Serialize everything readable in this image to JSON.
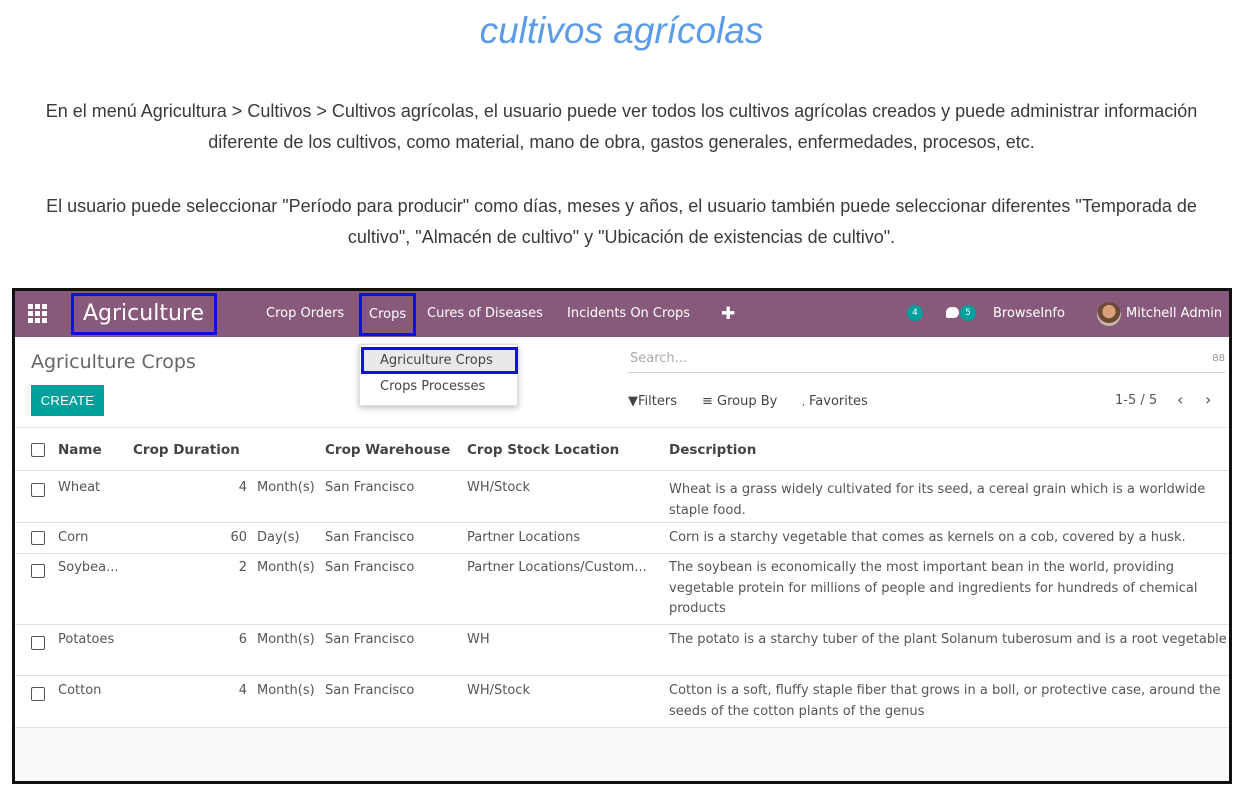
{
  "doc": {
    "title": "cultivos agrícolas",
    "para1": "En el menú Agricultura > Cultivos > Cultivos agrícolas, el usuario puede ver todos los cultivos agrícolas creados y puede administrar información diferente de los cultivos, como material, mano de obra, gastos generales, enfermedades, procesos, etc.",
    "para2": "El usuario puede seleccionar \"Período para producir\" como días, meses y años, el usuario también puede seleccionar diferentes \"Temporada de cultivo\", \"Almacén de cultivo\" y \"Ubicación de existencias de cultivo\"."
  },
  "navbar": {
    "brand": "Agriculture",
    "menu": [
      "Crop Orders",
      "Crops",
      "Cures of Diseases",
      "Incidents On Crops"
    ],
    "plus": "✚",
    "activity_count": "4",
    "message_count": "5",
    "company": "BrowseInfo",
    "user": "Mitchell Admin"
  },
  "dropdown": {
    "items": [
      "Agriculture Crops",
      "Crops Processes"
    ]
  },
  "control": {
    "title": "Agriculture Crops",
    "create": "CREATE",
    "search_placeholder": "Search...",
    "search_option": "88",
    "filters": "Filters",
    "group_by": "Group By",
    "favorites": "Favorites",
    "pager": "1-5 / 5",
    "prev": "‹",
    "next": "›"
  },
  "table": {
    "headers": [
      "Name",
      "Crop Duration",
      "Crop Warehouse",
      "Crop Stock Location",
      "Description"
    ],
    "rows": [
      {
        "name": "Wheat",
        "duration": "4",
        "unit": "Month(s)",
        "warehouse": "San Francisco",
        "location": "WH/Stock",
        "description": "Wheat is a grass widely cultivated for its seed, a cereal grain which is a worldwide staple food."
      },
      {
        "name": "Corn",
        "duration": "60",
        "unit": "Day(s)",
        "warehouse": "San Francisco",
        "location": "Partner Locations",
        "description": "Corn is a starchy vegetable that comes as kernels on a cob, covered by a husk."
      },
      {
        "name": "Soybea...",
        "duration": "2",
        "unit": "Month(s)",
        "warehouse": "San Francisco",
        "location": "Partner Locations/Custom...",
        "description": "The soybean is economically the most important bean in the world, providing vegetable protein for millions of people and ingredients for hundreds of chemical products"
      },
      {
        "name": "Potatoes",
        "duration": "6",
        "unit": "Month(s)",
        "warehouse": "San Francisco",
        "location": "WH",
        "description": "The potato is a starchy tuber of the plant Solanum tuberosum and is a root vegetable"
      },
      {
        "name": "Cotton",
        "duration": "4",
        "unit": "Month(s)",
        "warehouse": "San Francisco",
        "location": "WH/Stock",
        "description": "Cotton is a soft, fluffy staple fiber that grows in a boll, or protective case, around the seeds of the cotton plants of the genus"
      }
    ]
  }
}
